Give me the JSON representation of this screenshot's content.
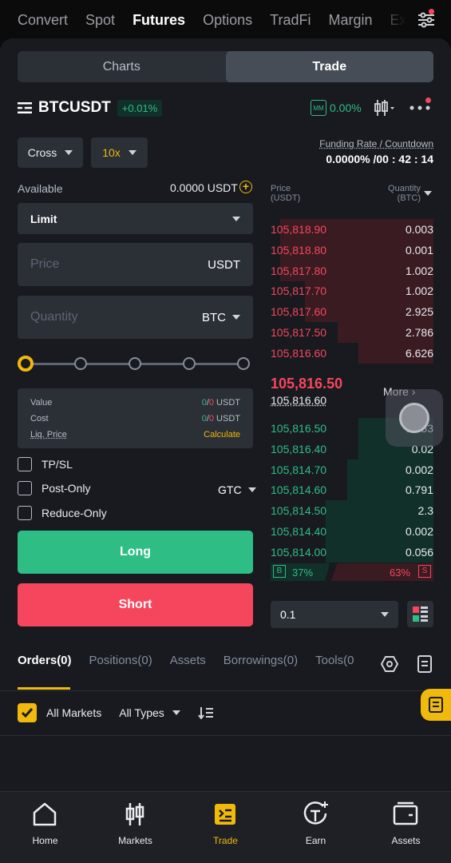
{
  "top_nav": [
    "Convert",
    "Spot",
    "Futures",
    "Options",
    "TradFi",
    "Margin",
    "Ex"
  ],
  "top_nav_active": "Futures",
  "mode_tabs": {
    "charts": "Charts",
    "trade": "Trade",
    "active": "Trade"
  },
  "symbol": {
    "name": "BTCUSDT",
    "change": "+0.01%",
    "mm": "MM",
    "mm_ratio": "0.00%"
  },
  "margin_mode": "Cross",
  "leverage": "10x",
  "funding": {
    "label": "Funding Rate / Countdown",
    "value": "0.0000% /00 : 42 : 14"
  },
  "available": {
    "label": "Available",
    "value": "0.0000 USDT"
  },
  "order_type": "Limit",
  "price_field": {
    "placeholder": "Price",
    "unit": "USDT"
  },
  "quantity_field": {
    "placeholder": "Quantity",
    "unit": "BTC"
  },
  "leverage_slider_value": 0,
  "info": {
    "value_label": "Value",
    "value_val_a": "0",
    "value_sep": "/",
    "value_val_b": "0",
    "value_unit": " USDT",
    "cost_label": "Cost",
    "cost_val_a": "0",
    "cost_sep": "/",
    "cost_val_b": "0",
    "cost_unit": " USDT",
    "liq_label": "Liq. Price",
    "liq_action": "Calculate"
  },
  "options": {
    "tpsl": "TP/SL",
    "post_only": "Post-Only",
    "reduce_only": "Reduce-Only",
    "tif": "GTC"
  },
  "buttons": {
    "long": "Long",
    "short": "Short"
  },
  "orderbook": {
    "price_header": "Price",
    "price_unit": "(USDT)",
    "qty_header": "Quantity",
    "qty_unit": "(BTC)",
    "asks": [
      {
        "price": "105,818.90",
        "qty": "0.003",
        "depth": 0.94
      },
      {
        "price": "105,818.80",
        "qty": "0.001",
        "depth": 0.94
      },
      {
        "price": "105,817.80",
        "qty": "1.002",
        "depth": 0.94
      },
      {
        "price": "105,817.70",
        "qty": "1.002",
        "depth": 0.79
      },
      {
        "price": "105,817.60",
        "qty": "2.925",
        "depth": 0.79
      },
      {
        "price": "105,817.50",
        "qty": "2.786",
        "depth": 0.59
      },
      {
        "price": "105,816.60",
        "qty": "6.626",
        "depth": 0.46
      }
    ],
    "last_price": "105,816.50",
    "mark_price": "105,816.60",
    "more": "More",
    "bids": [
      {
        "price": "105,816.50",
        "qty": "6.653",
        "depth": 0.46
      },
      {
        "price": "105,816.40",
        "qty": "0.02",
        "depth": 0.46
      },
      {
        "price": "105,814.70",
        "qty": "0.002",
        "depth": 0.53
      },
      {
        "price": "105,814.60",
        "qty": "0.791",
        "depth": 0.53
      },
      {
        "price": "105,814.50",
        "qty": "2.3",
        "depth": 0.66
      },
      {
        "price": "105,814.40",
        "qty": "0.002",
        "depth": 0.66
      },
      {
        "price": "105,814.00",
        "qty": "0.056",
        "depth": 0.66
      }
    ],
    "buy_label": "B",
    "buy_pct": "37%",
    "sell_pct": "63%",
    "sell_label": "S",
    "precision": "0.1"
  },
  "bottom_tabs": [
    "Orders(0)",
    "Positions(0)",
    "Assets",
    "Borrowings(0)",
    "Tools(0"
  ],
  "filters": {
    "all_markets": "All Markets",
    "all_types": "All Types"
  },
  "bottom_nav": [
    "Home",
    "Markets",
    "Trade",
    "Earn",
    "Assets"
  ],
  "colors": {
    "accent": "#f0b90b",
    "buy": "#2ebd85",
    "sell": "#f6465d",
    "bg": "#181a20"
  }
}
